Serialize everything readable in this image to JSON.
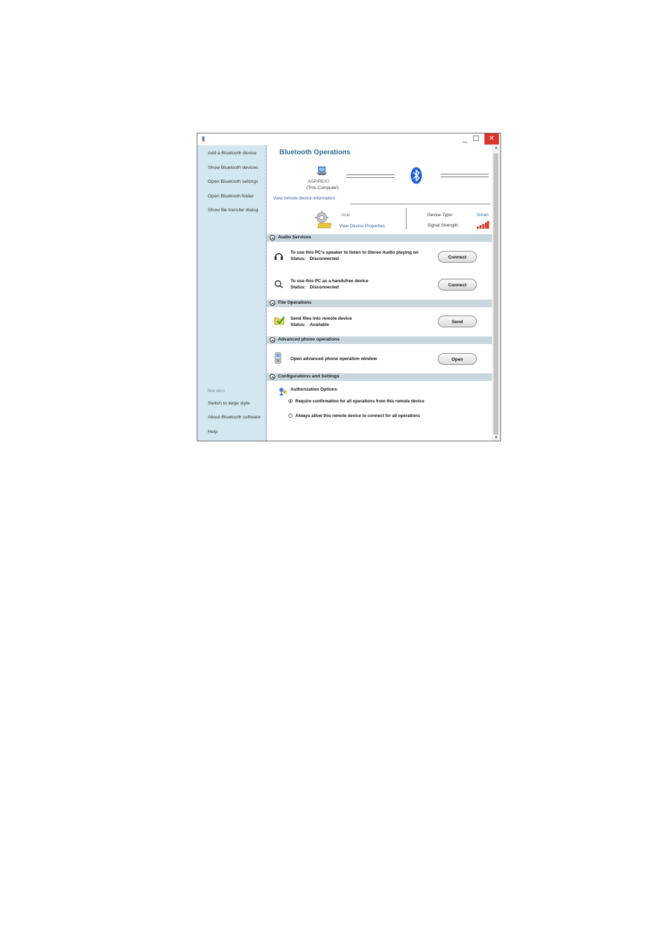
{
  "window": {
    "controls": {
      "minimize": "_",
      "maximize": "☐",
      "close": "✕"
    }
  },
  "sidebar": {
    "items": [
      {
        "label": "Add a Bluetooth device"
      },
      {
        "label": "Show Bluetooth devices"
      },
      {
        "label": "Open Bluetooth settings"
      },
      {
        "label": "Open Bluetooth folder"
      },
      {
        "label": "Show file transfer dialog"
      }
    ],
    "see_also_label": "See also",
    "see_also": [
      {
        "label": "Switch to large style"
      },
      {
        "label": "About Bluetooth software"
      },
      {
        "label": "Help"
      }
    ]
  },
  "main": {
    "heading": "Bluetooth Operations",
    "computer": {
      "name": "ASPIRES7",
      "subtitle": "(This Computer)"
    },
    "view_remote_info": "View remote device information",
    "remote_device": {
      "name": "Acer",
      "view_properties": "View Device Properties",
      "device_type_label": "Device Type:",
      "device_type_value": "Smart",
      "signal_label": "Signal Strength:"
    },
    "sections": {
      "audio": {
        "title": "Audio Services",
        "rows": [
          {
            "title": "To use this PC's speaker to listen to Stereo Audio playing on",
            "status_label": "Status:",
            "status": "Disconnected",
            "button": "Connect"
          },
          {
            "title": "To use this PC as a handsfree device",
            "status_label": "Status:",
            "status": "Disconnected",
            "button": "Connect"
          }
        ]
      },
      "file": {
        "title": "File Operations",
        "row": {
          "title": "Send files into remote device",
          "status_label": "Status:",
          "status": "Available",
          "button": "Send"
        }
      },
      "phone": {
        "title": "Advanced phone operations",
        "row": {
          "title": "Open advanced phone operation window",
          "button": "Open"
        }
      },
      "config": {
        "title": "Configurations and Settings",
        "auth_title": "Authorization Options",
        "options": [
          {
            "label": "Require confirmation for all operations from this remote device",
            "selected": true
          },
          {
            "label": "Always allow this remote device to connect for all operations",
            "selected": false
          }
        ]
      }
    }
  },
  "colors": {
    "sidebar_bg": "#d4e6ef",
    "heading": "#2a6f93",
    "link": "#2d5f9a",
    "section_header_bg": "#c8d6de",
    "close_button": "#d9352c",
    "bluetooth_blue": "#1f5fd6"
  },
  "icons": {
    "app": "bluetooth-app-icon",
    "computer": "laptop-icon",
    "bluetooth": "bluetooth-icon",
    "remote_device": "device-gear-icon",
    "signal": "signal-strength-icon",
    "headphones": "headphones-icon",
    "headset": "headset-icon",
    "send_files": "folder-check-icon",
    "phone": "phone-icon",
    "authorization": "authorization-icon"
  }
}
